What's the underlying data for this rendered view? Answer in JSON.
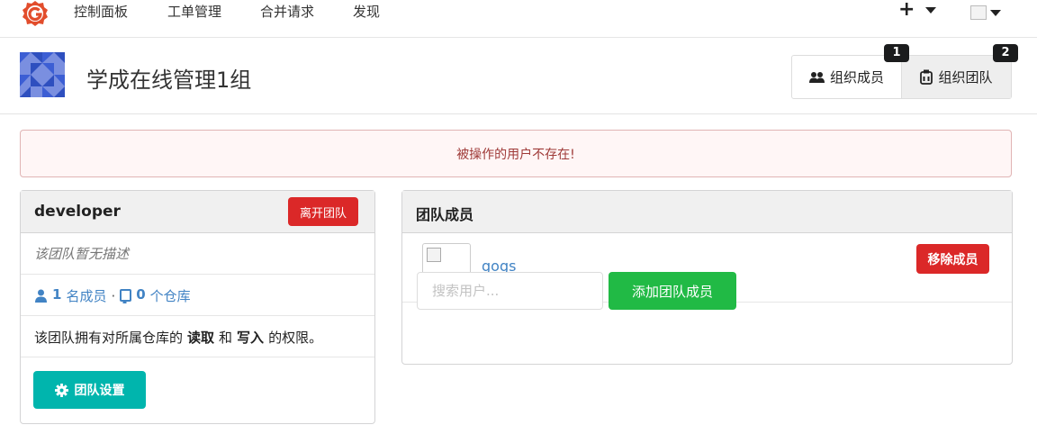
{
  "nav": {
    "items": [
      "控制面板",
      "工单管理",
      "合并请求",
      "发现"
    ],
    "plus_label": "+"
  },
  "header": {
    "org_name": "学成在线管理1组",
    "members_button": "组织成员",
    "members_badge": "1",
    "teams_button": "组织团队",
    "teams_badge": "2"
  },
  "alert": {
    "message": "被操作的用户不存在!"
  },
  "team": {
    "name": "developer",
    "leave_button": "离开团队",
    "description": "该团队暂无描述",
    "member_count": "1",
    "member_label": "名成员",
    "dot": "·",
    "repo_count": "0",
    "repo_label": "个仓库",
    "perm_prefix": "该团队拥有对所属仓库的",
    "perm_read": "读取",
    "perm_and": "和",
    "perm_write": "写入",
    "perm_suffix": "的权限。",
    "settings_button": "团队设置"
  },
  "members_panel": {
    "title": "团队成员",
    "member_name": "gogs",
    "remove_button": "移除成员",
    "search_placeholder": "搜索用户...",
    "add_button": "添加团队成员"
  },
  "colors": {
    "danger": "#db2828",
    "teal": "#00b5ad",
    "green": "#21ba45",
    "link": "#4183c4",
    "alert_bg": "#fff6f6",
    "alert_text": "#9f3a38"
  }
}
